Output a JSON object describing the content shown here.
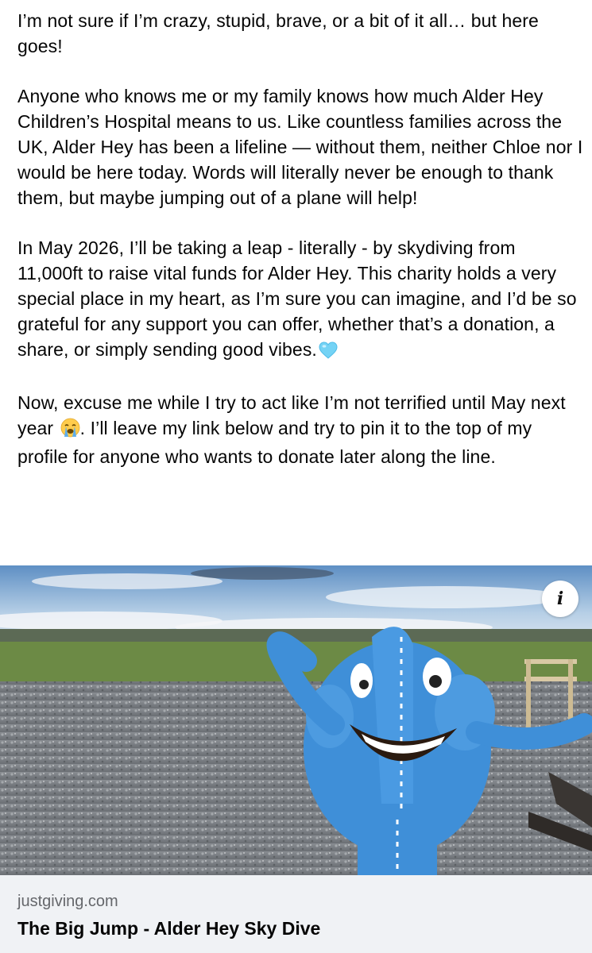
{
  "post": {
    "paragraph_1": "I’m not sure if I’m crazy, stupid, brave, or a bit of it all… but here goes!",
    "paragraph_2": "Anyone who knows me or my family knows how much Alder Hey Children’s Hospital means to us. Like countless families across the UK, Alder Hey has been a lifeline — without them, neither Chloe nor I would be here today. Words will literally never be enough to thank them, but maybe jumping out of a plane will help!",
    "paragraph_3": "In May 2026, I’ll be taking a leap - literally - by skydiving from 11,000ft to raise vital funds for Alder Hey. This charity holds a very special place in my heart, as I’m sure you can imagine, and I’d be so grateful for any support you can offer, whether that’s a donation, a share, or simply sending good vibes.",
    "paragraph_3_emoji": "🩵",
    "paragraph_4_part_1": "Now, excuse me while I try to act like I’m not terrified until May next year",
    "paragraph_4_emoji": "😭",
    "paragraph_4_part_2": ". I’ll leave my link below and try to pin it to the top of my profile for anyone who wants to donate later along the line."
  },
  "link_card": {
    "domain": "justgiving.com",
    "title": "The Big Jump - Alder Hey Sky Dive",
    "info_icon": "info-icon",
    "info_glyph": "i",
    "image_subject": "blue-elephant-mascot-photo"
  }
}
